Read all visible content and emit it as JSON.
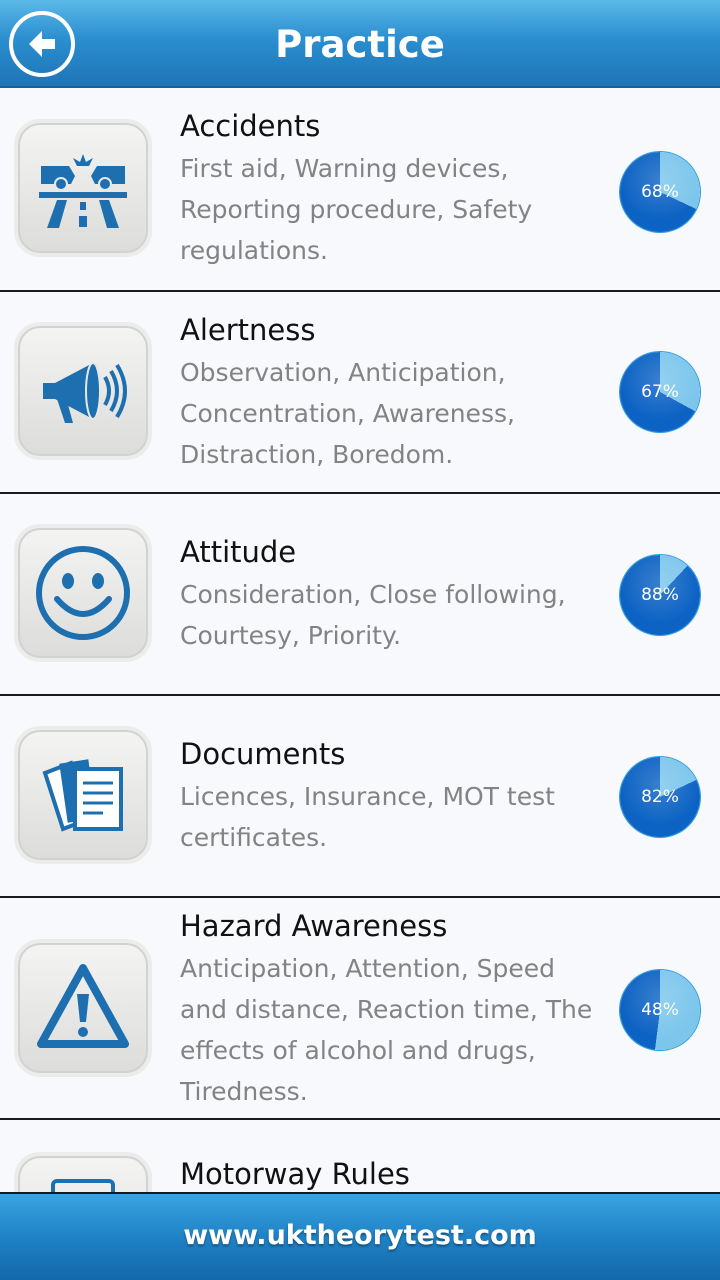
{
  "header": {
    "title": "Practice",
    "back_icon": "arrow-left-icon"
  },
  "colors": {
    "accent": "#1f74b6",
    "pie_dark": "#0d63c4",
    "pie_light": "#7cc6ec",
    "icon_blue": "#1e6fb0"
  },
  "items": [
    {
      "title": "Accidents",
      "desc": "First aid, Warning devices, Reporting procedure, Safety regulations.",
      "desc_lines": [
        "First aid, Warning devices,",
        "Reporting procedure, Safety",
        "regulations."
      ],
      "percent": 68,
      "percent_label": "68%",
      "icon": "road-crash-icon"
    },
    {
      "title": "Alertness",
      "desc_lines": [
        "Observation, Anticipation,",
        "Concentration, Awareness,",
        "Distraction, Boredom."
      ],
      "percent": 67,
      "percent_label": "67%",
      "icon": "megaphone-icon"
    },
    {
      "title": "Attitude",
      "desc_lines": [
        "Consideration, Close following,",
        "Courtesy, Priority."
      ],
      "percent": 88,
      "percent_label": "88%",
      "icon": "smiley-icon"
    },
    {
      "title": "Documents",
      "desc_lines": [
        "Licences, Insurance, MOT test",
        "certificates."
      ],
      "percent": 82,
      "percent_label": "82%",
      "icon": "documents-icon"
    },
    {
      "title": "Hazard Awareness",
      "desc_lines": [
        "Anticipation, Attention, Speed",
        "and distance, Reaction time, The",
        "effects of alcohol and drugs,",
        "Tiredness."
      ],
      "percent": 48,
      "percent_label": "48%",
      "icon": "warning-triangle-icon"
    },
    {
      "title": "Motorway Rules",
      "desc_lines": [],
      "percent": null,
      "percent_label": "",
      "icon": "speed-sign-icon"
    }
  ],
  "footer": {
    "text": "www.uktheorytest.com"
  }
}
